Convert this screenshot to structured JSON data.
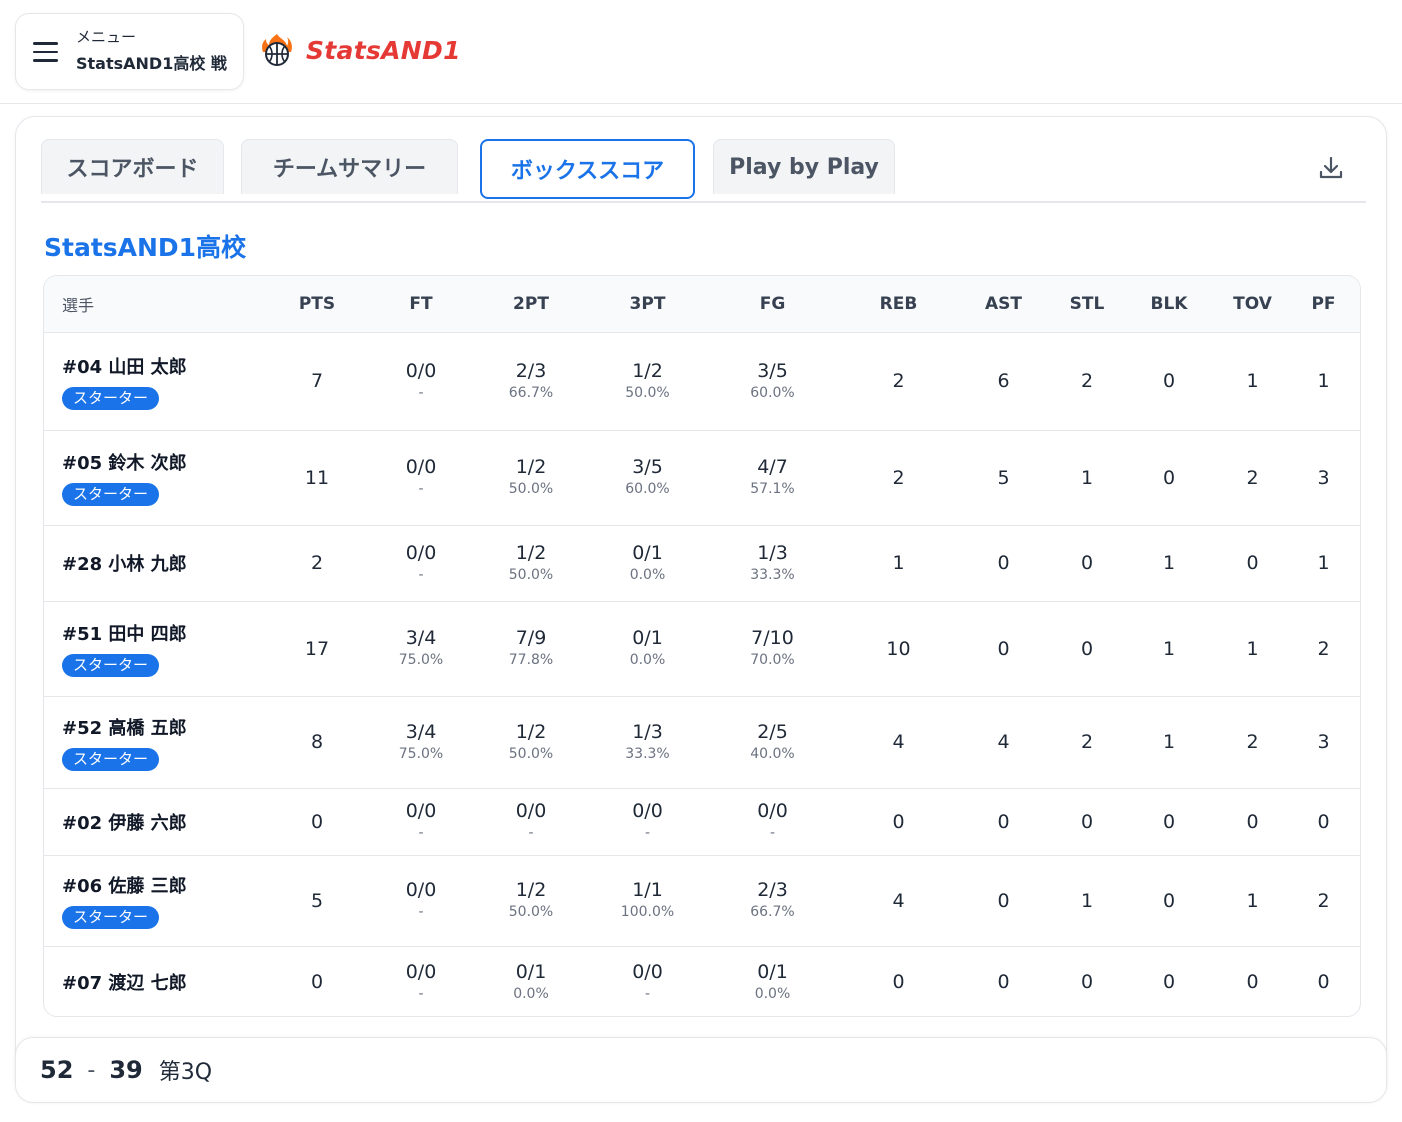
{
  "header": {
    "menu_label": "メニュー",
    "game_title": "StatsAND1高校 戦",
    "brand": "StatsAND1",
    "brand_color": "#e53935"
  },
  "tabs": [
    {
      "label": "スコアボード",
      "active": false
    },
    {
      "label": "チームサマリー",
      "active": false
    },
    {
      "label": "ボックススコア",
      "active": true
    },
    {
      "label": "Play by Play",
      "active": false
    }
  ],
  "toolbar": {
    "download_icon": "download-icon"
  },
  "team": {
    "name": "StatsAND1高校"
  },
  "table": {
    "columns": [
      "選手",
      "PTS",
      "FT",
      "2PT",
      "3PT",
      "FG",
      "REB",
      "AST",
      "STL",
      "BLK",
      "TOV",
      "PF"
    ],
    "starter_label": "スターター",
    "rows": [
      {
        "player": "#04  山田 太郎",
        "starter": true,
        "pts": "7",
        "ft": "0/0",
        "ft_pct": "-",
        "p2": "2/3",
        "p2_pct": "66.7%",
        "p3": "1/2",
        "p3_pct": "50.0%",
        "fg": "3/5",
        "fg_pct": "60.0%",
        "reb": "2",
        "ast": "6",
        "stl": "2",
        "blk": "0",
        "tov": "1",
        "pf": "1"
      },
      {
        "player": "#05  鈴木 次郎",
        "starter": true,
        "pts": "11",
        "ft": "0/0",
        "ft_pct": "-",
        "p2": "1/2",
        "p2_pct": "50.0%",
        "p3": "3/5",
        "p3_pct": "60.0%",
        "fg": "4/7",
        "fg_pct": "57.1%",
        "reb": "2",
        "ast": "5",
        "stl": "1",
        "blk": "0",
        "tov": "2",
        "pf": "3"
      },
      {
        "player": "#28  小林 九郎",
        "starter": false,
        "pts": "2",
        "ft": "0/0",
        "ft_pct": "-",
        "p2": "1/2",
        "p2_pct": "50.0%",
        "p3": "0/1",
        "p3_pct": "0.0%",
        "fg": "1/3",
        "fg_pct": "33.3%",
        "reb": "1",
        "ast": "0",
        "stl": "0",
        "blk": "1",
        "tov": "0",
        "pf": "1"
      },
      {
        "player": "#51  田中 四郎",
        "starter": true,
        "pts": "17",
        "ft": "3/4",
        "ft_pct": "75.0%",
        "p2": "7/9",
        "p2_pct": "77.8%",
        "p3": "0/1",
        "p3_pct": "0.0%",
        "fg": "7/10",
        "fg_pct": "70.0%",
        "reb": "10",
        "ast": "0",
        "stl": "0",
        "blk": "1",
        "tov": "1",
        "pf": "2"
      },
      {
        "player": "#52  高橋 五郎",
        "starter": true,
        "pts": "8",
        "ft": "3/4",
        "ft_pct": "75.0%",
        "p2": "1/2",
        "p2_pct": "50.0%",
        "p3": "1/3",
        "p3_pct": "33.3%",
        "fg": "2/5",
        "fg_pct": "40.0%",
        "reb": "4",
        "ast": "4",
        "stl": "2",
        "blk": "1",
        "tov": "2",
        "pf": "3"
      },
      {
        "player": "#02  伊藤 六郎",
        "starter": false,
        "pts": "0",
        "ft": "0/0",
        "ft_pct": "-",
        "p2": "0/0",
        "p2_pct": "-",
        "p3": "0/0",
        "p3_pct": "-",
        "fg": "0/0",
        "fg_pct": "-",
        "reb": "0",
        "ast": "0",
        "stl": "0",
        "blk": "0",
        "tov": "0",
        "pf": "0"
      },
      {
        "player": "#06  佐藤 三郎",
        "starter": true,
        "pts": "5",
        "ft": "0/0",
        "ft_pct": "-",
        "p2": "1/2",
        "p2_pct": "50.0%",
        "p3": "1/1",
        "p3_pct": "100.0%",
        "fg": "2/3",
        "fg_pct": "66.7%",
        "reb": "4",
        "ast": "0",
        "stl": "1",
        "blk": "0",
        "tov": "1",
        "pf": "2"
      },
      {
        "player": "#07  渡辺 七郎",
        "starter": false,
        "pts": "0",
        "ft": "0/0",
        "ft_pct": "-",
        "p2": "0/1",
        "p2_pct": "0.0%",
        "p3": "0/0",
        "p3_pct": "-",
        "fg": "0/1",
        "fg_pct": "0.0%",
        "reb": "0",
        "ast": "0",
        "stl": "0",
        "blk": "0",
        "tov": "0",
        "pf": "0"
      }
    ]
  },
  "scoreboard": {
    "home": "52",
    "separator": "-",
    "away": "39",
    "period": "第3Q"
  },
  "colors": {
    "accent": "#1a73e8",
    "border": "#e5e7eb"
  }
}
